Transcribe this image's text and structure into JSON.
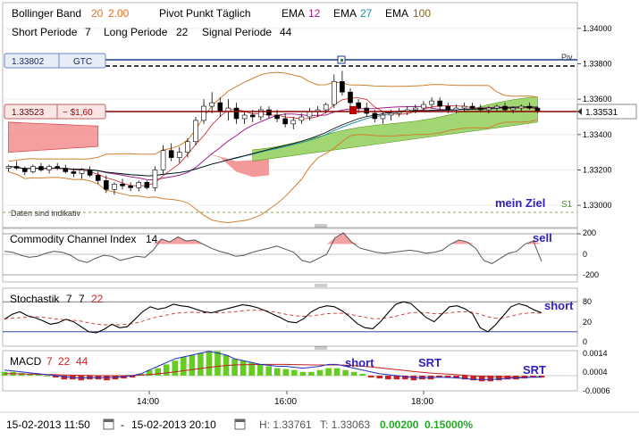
{
  "legend": {
    "bb_label": "Bollinger Band",
    "bb_p1": "20",
    "bb_p2": "2.00",
    "pivot_label": "Pivot Punkt Täglich",
    "ema_label": "EMA",
    "ema1": "12",
    "ema2": "27",
    "ema3": "100",
    "short_label": "Short Periode",
    "short_val": "7",
    "long_label": "Long Periode",
    "long_val": "22",
    "signal_label": "Signal Periode",
    "signal_val": "44"
  },
  "colors": {
    "bb_params": "#e07020",
    "ema12": "#a0208a",
    "ema27": "#2090a0",
    "ema100": "#8a6020",
    "upper_band": "#d08030",
    "lower_band": "#d08030",
    "cloud_green": "#8acc50",
    "cloud_red": "#f08080",
    "price_line": "#8b0000",
    "text_purple": "#3020c0",
    "macd_hist_pos": "#66cc22",
    "macd_hist_neg": "#cc2222"
  },
  "order_lines": {
    "gtc_price": "1.33802",
    "gtc_label": "GTC",
    "pos_price": "1.33523",
    "pos_pl": "− $1,60",
    "current_price": "1.33531",
    "piv_label": "Piv",
    "disclaimer": "Daten sind indikativ",
    "target_label": "mein Ziel",
    "s1_label": "S1"
  },
  "cci": {
    "label": "Commodity Channel Index",
    "period": "14",
    "annotation": "sell",
    "axis": [
      "200",
      "0",
      "-200"
    ]
  },
  "stoch": {
    "label": "Stochastik",
    "k": "7",
    "d": "7",
    "slow": "22",
    "annotation": "short",
    "axis": [
      "80",
      "20",
      "0"
    ]
  },
  "macd": {
    "label": "MACD",
    "p1": "7",
    "p2": "22",
    "p3": "44",
    "annotations": [
      "short",
      "SRT",
      "SRT"
    ],
    "axis": [
      "0.0014",
      "0.0004",
      "-0.0006"
    ]
  },
  "footer": {
    "from": "15-02-2013 11:50",
    "to": "15-02-2013 20:10",
    "dash": "-",
    "high": "H: 1.33761",
    "low": "T: 1.33063",
    "change": "0.00200",
    "change_pct": "0.15000%"
  },
  "chart_data": {
    "type": "candlestick",
    "x_ticks": [
      "14:00",
      "16:00",
      "18:00"
    ],
    "y_ticks": [
      "1.34000",
      "1.33800",
      "1.33600",
      "1.33400",
      "1.33200",
      "1.33000"
    ],
    "ylim": [
      1.3291,
      1.3412
    ],
    "candles": [
      [
        1.3321,
        1.3323,
        1.3319,
        1.3322
      ],
      [
        1.3322,
        1.3325,
        1.332,
        1.3321
      ],
      [
        1.3321,
        1.3322,
        1.3317,
        1.3319
      ],
      [
        1.3319,
        1.3323,
        1.3318,
        1.3322
      ],
      [
        1.3322,
        1.3324,
        1.3319,
        1.332
      ],
      [
        1.332,
        1.3323,
        1.3318,
        1.3322
      ],
      [
        1.3322,
        1.3324,
        1.332,
        1.3321
      ],
      [
        1.3321,
        1.3323,
        1.3318,
        1.3319
      ],
      [
        1.3319,
        1.3321,
        1.3316,
        1.3318
      ],
      [
        1.3318,
        1.3321,
        1.3315,
        1.332
      ],
      [
        1.332,
        1.3322,
        1.3316,
        1.3317
      ],
      [
        1.3317,
        1.3319,
        1.3312,
        1.3314
      ],
      [
        1.3314,
        1.3317,
        1.3307,
        1.3309
      ],
      [
        1.3309,
        1.3313,
        1.3306,
        1.3312
      ],
      [
        1.3312,
        1.3315,
        1.3309,
        1.3311
      ],
      [
        1.3311,
        1.3313,
        1.3308,
        1.331
      ],
      [
        1.331,
        1.3314,
        1.3308,
        1.3313
      ],
      [
        1.3313,
        1.3314,
        1.3309,
        1.331
      ],
      [
        1.331,
        1.3322,
        1.3308,
        1.332
      ],
      [
        1.332,
        1.3334,
        1.3318,
        1.3331
      ],
      [
        1.3331,
        1.3335,
        1.3325,
        1.3327
      ],
      [
        1.3327,
        1.3333,
        1.3324,
        1.333
      ],
      [
        1.333,
        1.3338,
        1.3327,
        1.3336
      ],
      [
        1.3336,
        1.335,
        1.3334,
        1.3348
      ],
      [
        1.3348,
        1.336,
        1.3346,
        1.3356
      ],
      [
        1.3356,
        1.3364,
        1.3352,
        1.3358
      ],
      [
        1.3358,
        1.3361,
        1.335,
        1.3353
      ],
      [
        1.3353,
        1.336,
        1.3348,
        1.3355
      ],
      [
        1.3355,
        1.3358,
        1.3346,
        1.3349
      ],
      [
        1.3349,
        1.3353,
        1.3346,
        1.3351
      ],
      [
        1.3351,
        1.3354,
        1.3347,
        1.335
      ],
      [
        1.335,
        1.3356,
        1.3348,
        1.3354
      ],
      [
        1.3354,
        1.3356,
        1.3349,
        1.3351
      ],
      [
        1.3351,
        1.3354,
        1.3347,
        1.3349
      ],
      [
        1.3349,
        1.3352,
        1.3344,
        1.3346
      ],
      [
        1.3346,
        1.335,
        1.3343,
        1.3348
      ],
      [
        1.3348,
        1.3352,
        1.3346,
        1.335
      ],
      [
        1.335,
        1.3355,
        1.3348,
        1.3353
      ],
      [
        1.3353,
        1.3356,
        1.335,
        1.3354
      ],
      [
        1.3354,
        1.3358,
        1.3352,
        1.3357
      ],
      [
        1.3357,
        1.3374,
        1.3355,
        1.337
      ],
      [
        1.337,
        1.3376,
        1.3362,
        1.3364
      ],
      [
        1.3364,
        1.3366,
        1.3356,
        1.3358
      ],
      [
        1.3358,
        1.336,
        1.3352,
        1.3355
      ],
      [
        1.3355,
        1.3358,
        1.335,
        1.3352
      ],
      [
        1.3352,
        1.3354,
        1.3347,
        1.3349
      ],
      [
        1.3349,
        1.3353,
        1.3346,
        1.3351
      ],
      [
        1.3351,
        1.3354,
        1.3348,
        1.3352
      ],
      [
        1.3352,
        1.3355,
        1.335,
        1.3353
      ],
      [
        1.3353,
        1.3356,
        1.3351,
        1.3354
      ],
      [
        1.3354,
        1.3357,
        1.3352,
        1.3355
      ],
      [
        1.3355,
        1.3359,
        1.3353,
        1.3357
      ],
      [
        1.3357,
        1.3361,
        1.3355,
        1.3359
      ],
      [
        1.3359,
        1.3361,
        1.3354,
        1.3356
      ],
      [
        1.3356,
        1.3358,
        1.3352,
        1.3354
      ],
      [
        1.3354,
        1.3357,
        1.3352,
        1.3355
      ],
      [
        1.3355,
        1.3358,
        1.3353,
        1.3356
      ],
      [
        1.3356,
        1.3358,
        1.3354,
        1.3355
      ],
      [
        1.3355,
        1.3357,
        1.3353,
        1.3354
      ],
      [
        1.3354,
        1.3356,
        1.3352,
        1.3355
      ],
      [
        1.3355,
        1.3357,
        1.3353,
        1.3356
      ],
      [
        1.3356,
        1.3358,
        1.3353,
        1.3354
      ],
      [
        1.3354,
        1.3356,
        1.3352,
        1.3355
      ],
      [
        1.3355,
        1.3357,
        1.3353,
        1.3356
      ],
      [
        1.3356,
        1.3358,
        1.3354,
        1.3355
      ],
      [
        1.3355,
        1.3356,
        1.3352,
        1.3353
      ]
    ],
    "cci": [
      30,
      20,
      -10,
      -30,
      -20,
      10,
      30,
      20,
      -10,
      -60,
      -80,
      -40,
      -10,
      -20,
      -60,
      -40,
      -20,
      -30,
      40,
      150,
      120,
      170,
      130,
      140,
      100,
      60,
      30,
      10,
      -20,
      -10,
      20,
      40,
      60,
      80,
      50,
      20,
      -60,
      -80,
      -40,
      0,
      160,
      210,
      120,
      60,
      40,
      20,
      10,
      20,
      30,
      40,
      30,
      10,
      20,
      40,
      100,
      140,
      120,
      60,
      -60,
      -90,
      -40,
      10,
      30,
      100,
      130,
      -70
    ],
    "stoch_k": [
      45,
      55,
      60,
      52,
      48,
      42,
      35,
      38,
      45,
      40,
      30,
      20,
      18,
      25,
      35,
      28,
      30,
      45,
      60,
      70,
      65,
      68,
      75,
      72,
      70,
      65,
      60,
      58,
      62,
      66,
      70,
      74,
      72,
      68,
      62,
      55,
      48,
      40,
      38,
      46,
      60,
      68,
      72,
      70,
      62,
      50,
      36,
      28,
      26,
      40,
      58,
      75,
      80,
      76,
      62,
      48,
      40,
      55,
      70,
      72,
      66,
      56,
      28,
      20,
      34,
      52,
      70,
      76,
      72,
      64,
      58
    ],
    "stoch_d": [
      46,
      47,
      48,
      49,
      50,
      49,
      47,
      45,
      44,
      43,
      41,
      38,
      35,
      34,
      34,
      34,
      35,
      37,
      41,
      46,
      50,
      53,
      56,
      58,
      59,
      59,
      58,
      58,
      58,
      59,
      60,
      62,
      63,
      63,
      62,
      60,
      57,
      54,
      52,
      51,
      52,
      54,
      56,
      57,
      57,
      55,
      52,
      49,
      46,
      46,
      48,
      51,
      55,
      58,
      59,
      58,
      56,
      56,
      58,
      60,
      60,
      59,
      55,
      50,
      47,
      48,
      51,
      55,
      57,
      58,
      57
    ],
    "stoch_lines": {
      "upper": 80,
      "lower": 20
    },
    "macd_hist": [
      0.0002,
      0.0002,
      0.00015,
      0.0001,
      5e-05,
      0,
      -0.0001,
      -0.0002,
      -0.0002,
      -0.00025,
      -0.0002,
      -0.0002,
      -0.00025,
      -0.0002,
      -0.00015,
      -0.0001,
      0.0001,
      0.0003,
      0.0004,
      0.0006,
      0.0008,
      0.001,
      0.0011,
      0.0012,
      0.0013,
      0.0013,
      0.0011,
      0.0009,
      0.0008,
      0.0007,
      0.0006,
      0.0005,
      0.0004,
      0.00035,
      0.0003,
      0.0002,
      0.0002,
      0.0003,
      0.0004,
      0.0004,
      0.0003,
      0.0002,
      0.0001,
      -0.0001,
      -0.00015,
      -0.0002,
      -0.0002,
      -0.0002,
      -0.00025,
      -0.0002,
      -0.0002,
      -0.0001,
      -0.0001,
      -0.00015,
      -0.0002,
      -0.00025,
      -0.0003,
      -0.0003,
      -0.00025,
      -0.0002,
      -0.0002,
      -0.00015,
      -0.0001,
      -0.0001
    ],
    "macd_line": [
      0.0003,
      0.00025,
      0.0002,
      0.00015,
      0.0001,
      5e-05,
      0,
      -5e-05,
      -0.0001,
      -0.00012,
      -0.0001,
      -0.0001,
      -0.0001,
      -8e-05,
      -5e-05,
      0,
      0.0001,
      0.0003,
      0.0005,
      0.0007,
      0.0009,
      0.001,
      0.0011,
      0.0012,
      0.0013,
      0.0012,
      0.0011,
      0.0009,
      0.0008,
      0.0007,
      0.0006,
      0.00055,
      0.0005,
      0.0005,
      0.00045,
      0.0004,
      0.00045,
      0.0005,
      0.0006,
      0.0006,
      0.0005,
      0.0004,
      0.0003,
      0.0002,
      0.0001,
      5e-05,
      0,
      -5e-05,
      -0.0001,
      -0.0001,
      -0.0001,
      -8e-05,
      -0.0001,
      -0.00012,
      -0.00015,
      -0.0002,
      -0.0002,
      -0.0002,
      -0.00018,
      -0.00015,
      -0.00012,
      -0.0001,
      -8e-05,
      -6e-05
    ],
    "macd_signal": [
      0.0001,
      0.0001,
      9e-05,
      8e-05,
      7e-05,
      6e-05,
      5e-05,
      4e-05,
      3e-05,
      2e-05,
      1e-05,
      0,
      0,
      0,
      0,
      1e-05,
      3e-05,
      6e-05,
      0.0001,
      0.00015,
      0.0002,
      0.00026,
      0.00032,
      0.00038,
      0.00044,
      0.0005,
      0.00054,
      0.00057,
      0.00058,
      0.00059,
      0.0006,
      0.0006,
      0.0006,
      0.0006,
      0.00059,
      0.00058,
      0.00057,
      0.00057,
      0.00057,
      0.00057,
      0.00056,
      0.00054,
      0.0005,
      0.00046,
      0.00042,
      0.00037,
      0.00032,
      0.00027,
      0.00022,
      0.00018,
      0.00014,
      0.00011,
      8e-05,
      5e-05,
      2e-05,
      -1e-05,
      -3e-05,
      -5e-05,
      -6e-05,
      -7e-05,
      -8e-05,
      -8e-05,
      -8e-05,
      -8e-05
    ]
  }
}
